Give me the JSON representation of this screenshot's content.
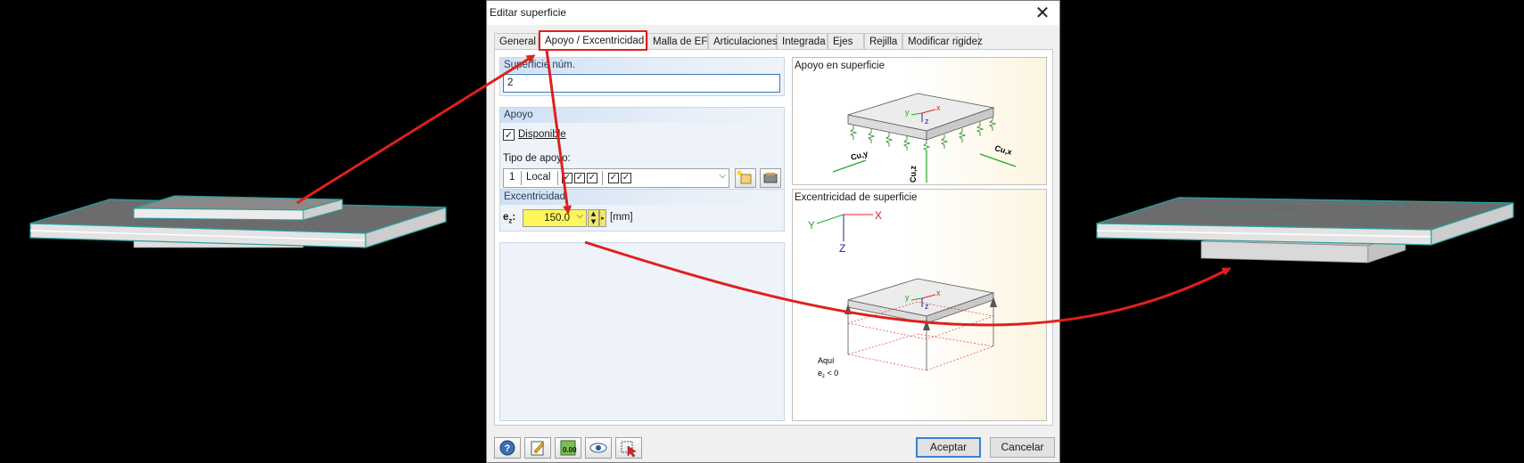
{
  "dialog": {
    "title": "Editar superficie",
    "close_icon": "close-icon",
    "tabs": [
      {
        "label": "General"
      },
      {
        "label": "Apoyo / Excentricidad"
      },
      {
        "label": "Malla de EF"
      },
      {
        "label": "Articulaciones"
      },
      {
        "label": "Integrada"
      },
      {
        "label": "Ejes"
      },
      {
        "label": "Rejilla"
      },
      {
        "label": "Modificar rigidez"
      }
    ],
    "active_tab": "Apoyo / Excentricidad"
  },
  "surface": {
    "group_title": "Superficie núm.",
    "number": "2"
  },
  "support": {
    "group_title": "Apoyo",
    "available_label": "Disponible",
    "available_checked": true,
    "type_label": "Tipo de apoyo:",
    "type_number": "1",
    "type_name": "Local",
    "check_mark": "✓"
  },
  "eccentricity": {
    "group_title": "Excentricidad",
    "ez_label": "e",
    "ez_sub": "z",
    "ez_colon": ":",
    "ez_value": "150.0",
    "unit": "[mm]"
  },
  "images": {
    "support_title": "Apoyo en superficie",
    "support_labels": {
      "x": "x",
      "y": "y",
      "z": "z",
      "cuy": "Cu,y",
      "cux": "Cu,x",
      "cuz": "Cu,z"
    },
    "ecc_title": "Excentricidad de superficie",
    "ecc_labels": {
      "X": "X",
      "Y": "Y",
      "Z": "Z",
      "x": "x",
      "y": "y",
      "z": "z",
      "note1": "Aquí",
      "note2": "e",
      "note2_sub": "z",
      "note2_rest": " < 0"
    }
  },
  "buttons": {
    "ok": "Aceptar",
    "cancel": "Cancelar",
    "icons": [
      "help-icon",
      "edit-icon",
      "calculator-icon",
      "view-icon",
      "select-icon"
    ]
  },
  "colors": {
    "accent_red": "#e0201c",
    "field_yellow": "#fff65a",
    "group_blue": "#cfe0f4",
    "slab_edge": "#2a9c9c"
  }
}
